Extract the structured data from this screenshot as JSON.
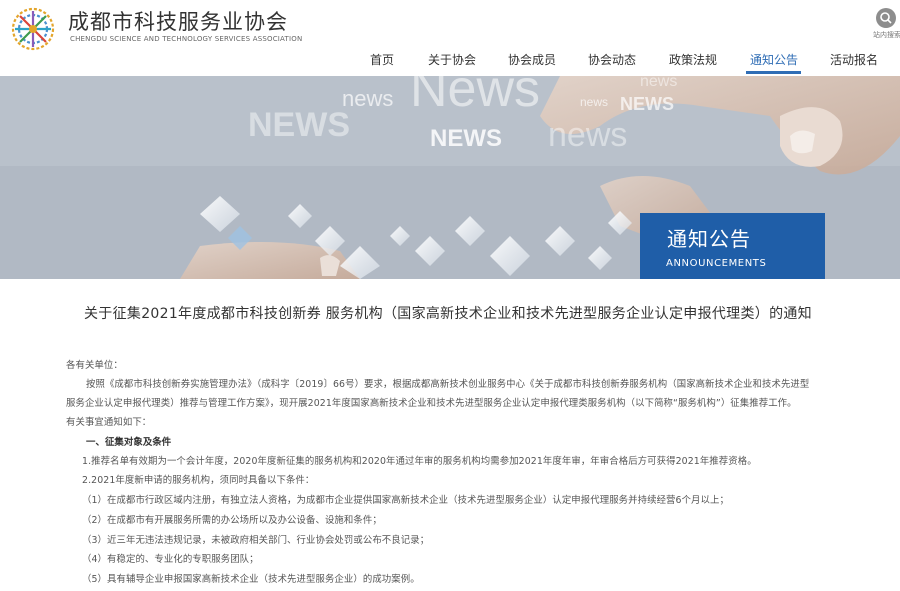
{
  "header": {
    "org_name": "成都市科技服务业协会",
    "org_name_en": "CHENGDU SCIENCE AND TECHNOLOGY SERVICES ASSOCIATION",
    "search_label": "站内搜索"
  },
  "nav": {
    "items": [
      {
        "label": "首页"
      },
      {
        "label": "关于协会"
      },
      {
        "label": "协会成员"
      },
      {
        "label": "协会动态"
      },
      {
        "label": "政策法规"
      },
      {
        "label": "通知公告"
      },
      {
        "label": "活动报名"
      }
    ],
    "active": "通知公告"
  },
  "banner": {
    "bg_words": [
      "news",
      "News",
      "news",
      "NEWS",
      "NEWS",
      "NEWS",
      "news",
      "news"
    ],
    "title": "通知公告",
    "subtitle": "ANNOUNCEMENTS"
  },
  "article": {
    "title": "关于征集2021年度成都市科技创新券 服务机构（国家高新技术企业和技术先进型服务企业认定申报代理类）的通知",
    "lines": [
      "各有关单位：",
      "按照《成都市科技创新券实施管理办法》（成科字〔2019〕66号）要求，根据成都高新技术创业服务中心《关于成都市科技创新券服务机构（国家高新技术企业和技术先进型",
      "服务企业认定申报代理类）推荐与管理工作方案》，现开展2021年度国家高新技术企业和技术先进型服务企业认定申报代理类服务机构（以下简称“服务机构”）征集推荐工作。",
      "有关事宜通知如下：",
      "一、征集对象及条件",
      "1.推荐名单有效期为一个会计年度，2020年度新征集的服务机构和2020年通过年审的服务机构均需参加2021年度年审，年审合格后方可获得2021年推荐资格。",
      "2.2021年度新申请的服务机构，须同时具备以下条件：",
      "（1）在成都市行政区域内注册，有独立法人资格，为成都市企业提供国家高新技术企业（技术先进型服务企业）认定申报代理服务并持续经营6个月以上；",
      "（2）在成都市有开展服务所需的办公场所以及办公设备、设施和条件；",
      "（3）近三年无违法违规记录，未被政府相关部门、行业协会处罚或公布不良记录；",
      "（4）有稳定的、专业化的专职服务团队；",
      "（5）具有辅导企业申报国家高新技术企业（技术先进型服务企业）的成功案例。"
    ]
  },
  "colors": {
    "accent": "#2f6db5",
    "banner_box": "#1f5ea8"
  }
}
